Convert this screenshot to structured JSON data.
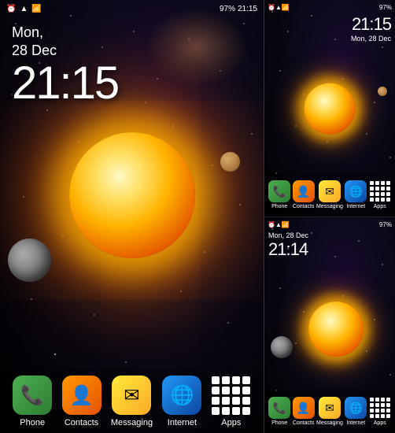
{
  "main": {
    "date": "Mon,",
    "date2": "28 Dec",
    "time": "21:15",
    "status": {
      "battery": "97%",
      "clock": "21:15",
      "signal": "▲▼",
      "wifi": "WiFi",
      "alarm": "⏰"
    }
  },
  "dock": {
    "items": [
      {
        "id": "phone",
        "label": "Phone",
        "icon": "📞",
        "class": "phone"
      },
      {
        "id": "contacts",
        "label": "Contacts",
        "icon": "👤",
        "class": "contacts"
      },
      {
        "id": "messaging",
        "label": "Messaging",
        "icon": "✉",
        "class": "messaging"
      },
      {
        "id": "internet",
        "label": "Internet",
        "icon": "🌐",
        "class": "internet"
      },
      {
        "id": "apps",
        "label": "Apps",
        "icon": "grid",
        "class": "apps"
      }
    ]
  },
  "panel_top": {
    "date": "Mon,",
    "date2": "28 Dec",
    "time": "21:15",
    "battery": "97%"
  },
  "panel_bottom": {
    "date": "Mon,",
    "date2": "28 Dec",
    "time": "21:14",
    "battery": "97%"
  }
}
